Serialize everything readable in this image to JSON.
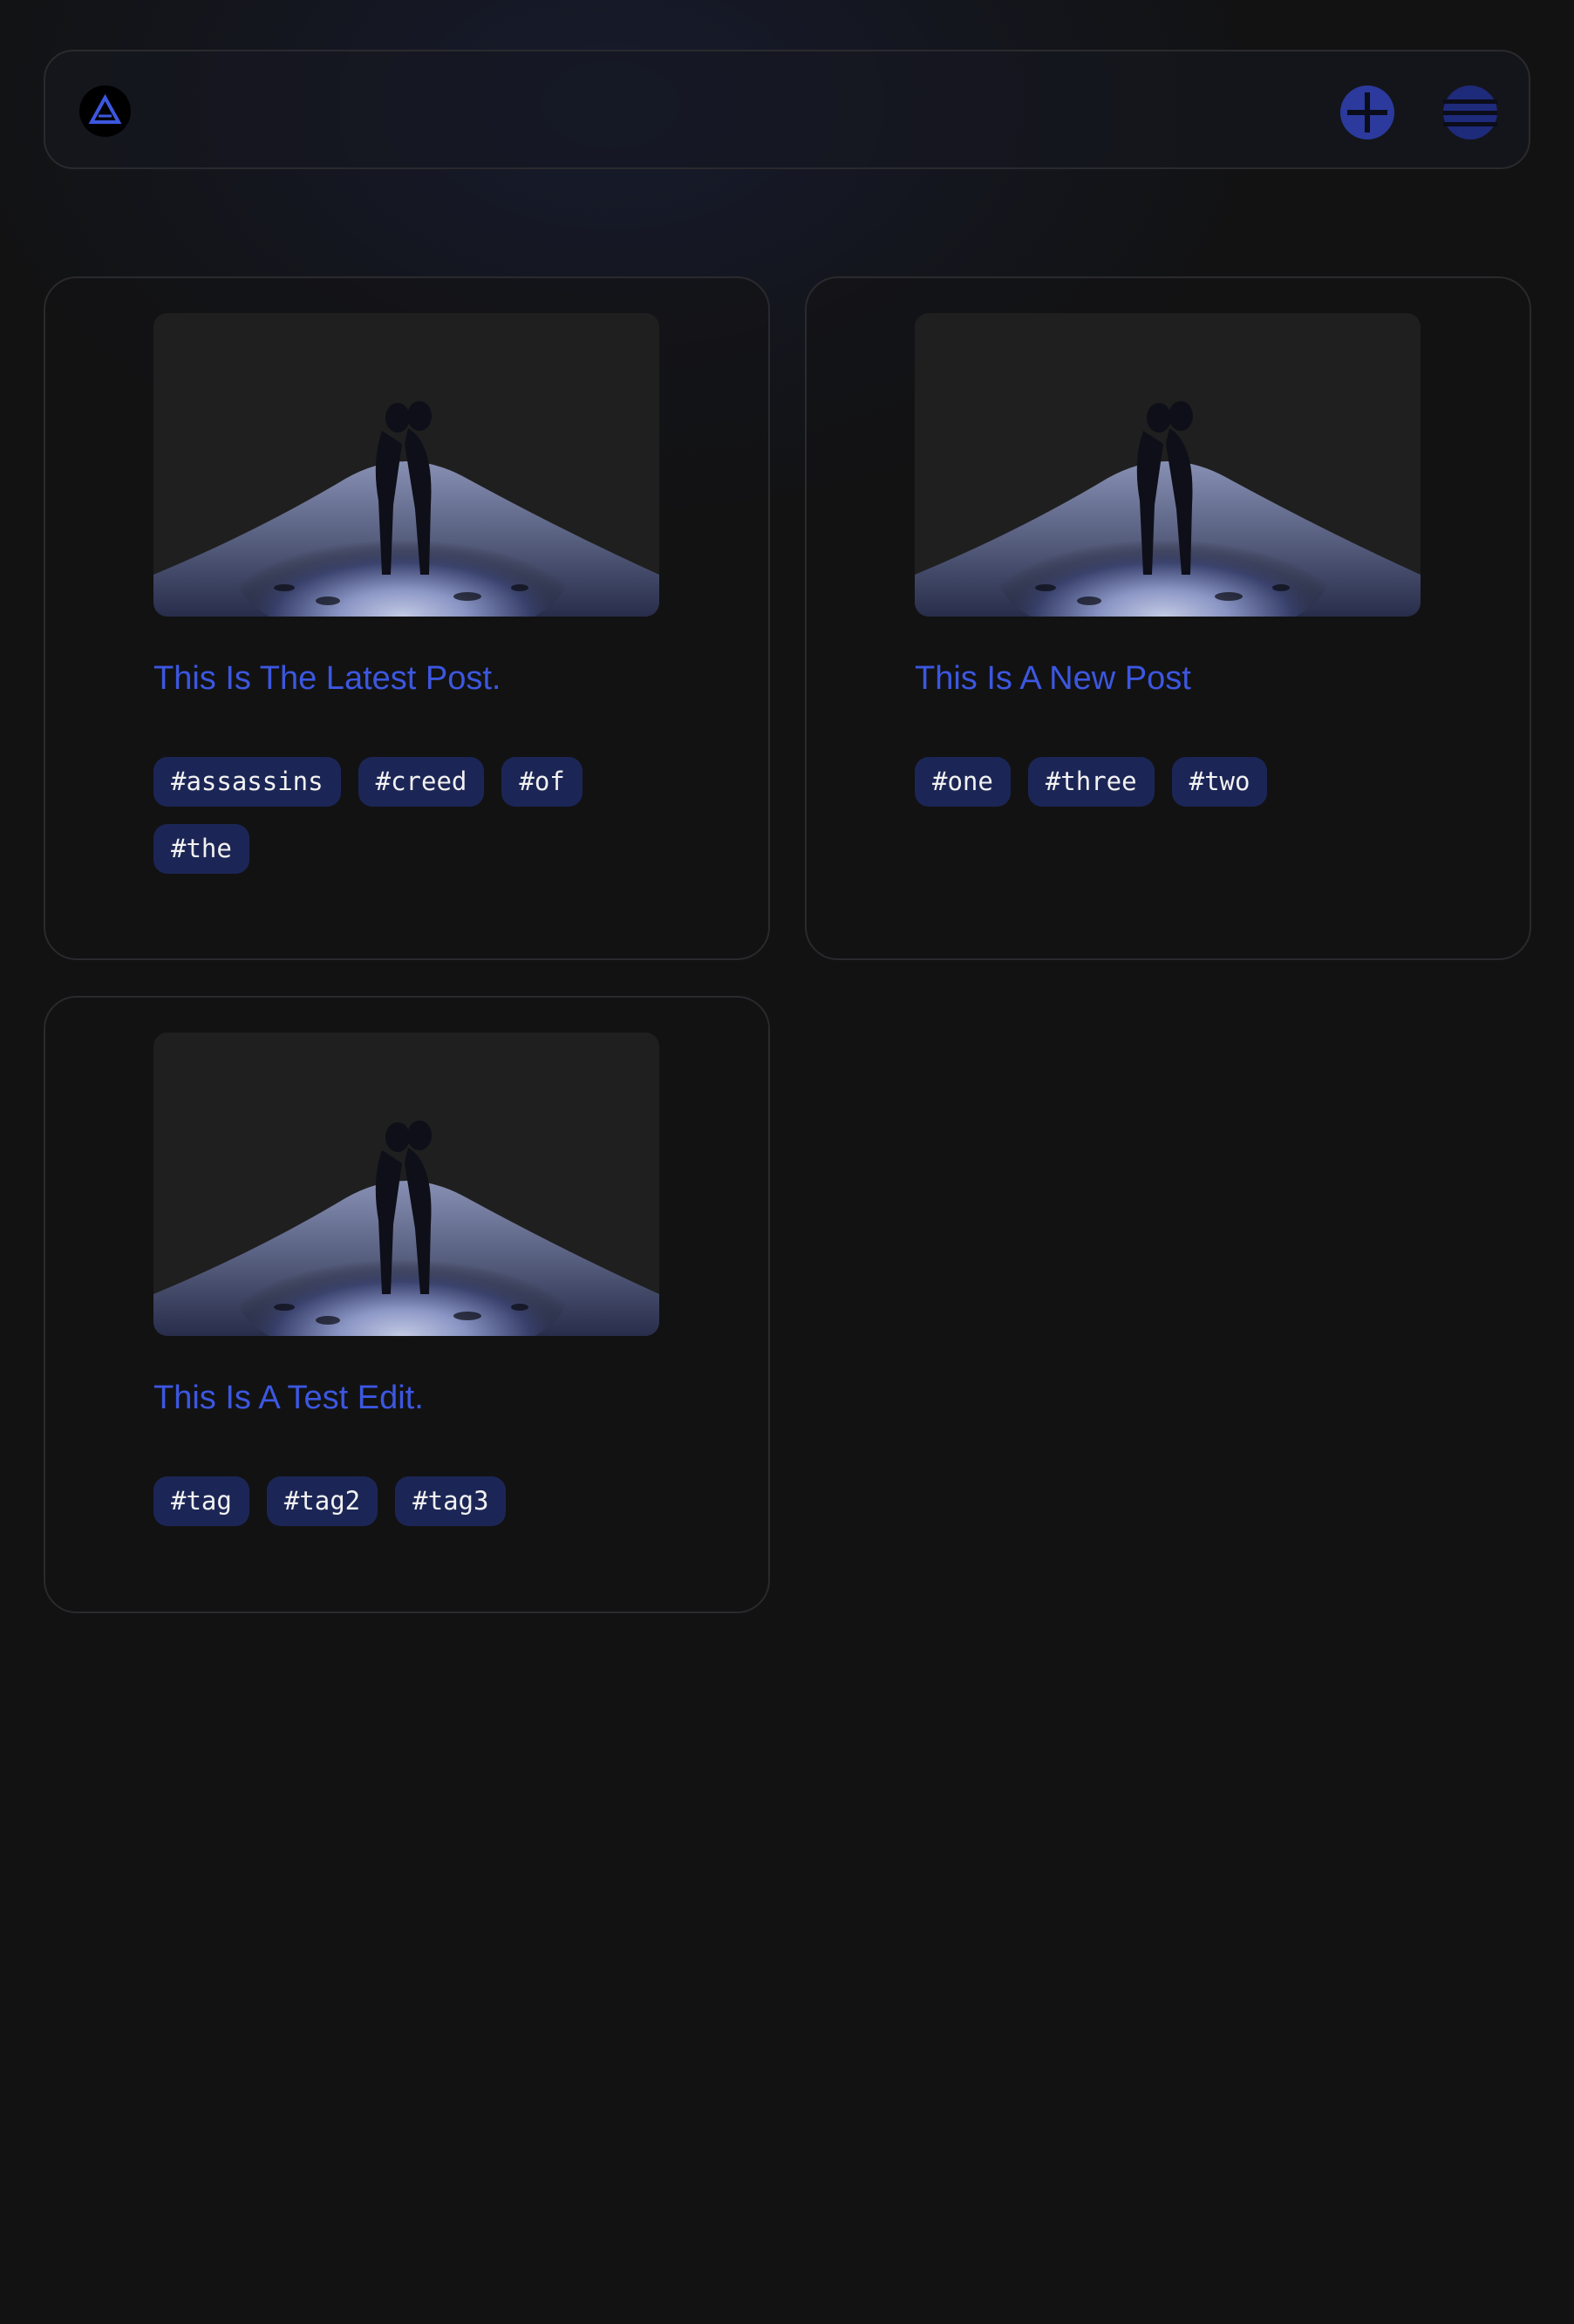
{
  "header": {
    "logo_icon": "app-logo-icon",
    "add_icon": "plus-circle-icon",
    "menu_icon": "hamburger-menu-icon",
    "accent_color": "#3c57e0"
  },
  "posts": [
    {
      "title": "This Is The Latest Post.",
      "image": "couple-silhouette-night-photo",
      "tags": [
        "#assassins",
        "#creed",
        "#of",
        "#the"
      ]
    },
    {
      "title": "This Is A New Post",
      "image": "couple-silhouette-night-photo",
      "tags": [
        "#one",
        "#three",
        "#two"
      ]
    },
    {
      "title": "This Is A Test Edit.",
      "image": "couple-silhouette-night-photo",
      "tags": [
        "#tag",
        "#tag2",
        "#tag3"
      ]
    }
  ]
}
